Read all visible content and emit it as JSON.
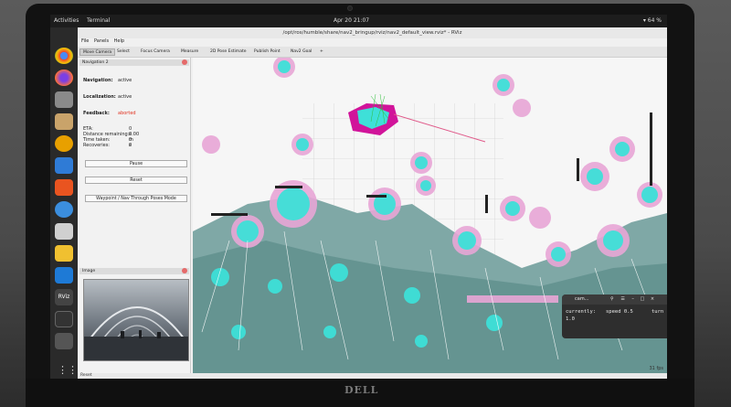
{
  "gnome": {
    "activities": "Activities",
    "app_name": "Terminal",
    "clock": "Apr 20  21:07",
    "battery": "64 %"
  },
  "rviz": {
    "title": "/opt/ros/humble/share/nav2_bringup/rviz/nav2_default_view.rviz* - RViz",
    "menu": [
      "File",
      "Panels",
      "Help"
    ],
    "tools": [
      "Move Camera",
      "Select",
      "Focus Camera",
      "Measure",
      "2D Pose Estimate",
      "Publish Point",
      "Nav2 Goal"
    ],
    "status_bar": "Reset",
    "fps": "31 fps"
  },
  "navigation_panel": {
    "header": "Navigation 2",
    "navigation_label": "Navigation:",
    "navigation_value": "active",
    "localization_label": "Localization:",
    "localization_value": "active",
    "feedback_label": "Feedback:",
    "feedback_value": "aborted",
    "eta_label": "ETA:",
    "eta_value": "0 s",
    "distance_label": "Distance remaining:",
    "distance_value": "0.00 m",
    "time_label": "Time taken:",
    "time_value": "0 s",
    "recoveries_label": "Recoveries:",
    "recoveries_value": "0",
    "pause_button": "Pause",
    "reset_button": "Reset",
    "mode_button": "Waypoint / Nav Through Poses Mode"
  },
  "image_panel": {
    "header": "Image"
  },
  "terminal": {
    "title": "cam...",
    "line1_left": "currently:",
    "line1_mid": "speed 0.5",
    "line1_right": "turn",
    "line2": "1.0"
  },
  "colors": {
    "feedback_aborted": "#e0301e",
    "costmap_cyan": "#3ee0d8",
    "inflation_pink": "#e8a6d6",
    "lethal_magenta": "#d1149a"
  }
}
